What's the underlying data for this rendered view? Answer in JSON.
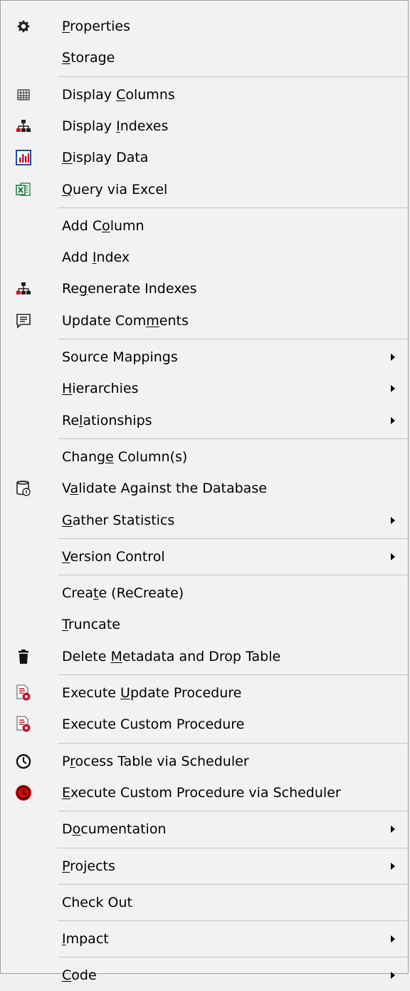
{
  "menu": {
    "items": [
      {
        "label": "Properties",
        "ul": 0,
        "icon": "gear-icon",
        "arrow": false
      },
      {
        "label": "Storage",
        "ul": 0,
        "icon": "",
        "arrow": false
      },
      {
        "sep": true
      },
      {
        "label": "Display Columns",
        "ul": 8,
        "icon": "columns-grid-icon",
        "arrow": false
      },
      {
        "label": "Display Indexes",
        "ul": 8,
        "icon": "index-tree-icon",
        "arrow": false
      },
      {
        "label": "Display Data",
        "ul": 0,
        "icon": "bar-chart-icon",
        "arrow": false
      },
      {
        "label": "Query via Excel",
        "ul": 0,
        "icon": "excel-icon",
        "arrow": false
      },
      {
        "sep": true
      },
      {
        "label": "Add Column",
        "ul": 5,
        "icon": "",
        "arrow": false
      },
      {
        "label": "Add Index",
        "ul": 4,
        "icon": "",
        "arrow": false
      },
      {
        "label": "Regenerate Indexes",
        "ul": 2,
        "icon": "index-tree-icon",
        "arrow": false
      },
      {
        "label": "Update Comments",
        "ul": 10,
        "icon": "comment-icon",
        "arrow": false
      },
      {
        "sep": true
      },
      {
        "label": "Source Mappings",
        "ul": -1,
        "icon": "",
        "arrow": true
      },
      {
        "label": "Hierarchies",
        "ul": 0,
        "icon": "",
        "arrow": true
      },
      {
        "label": "Relationships",
        "ul": 2,
        "icon": "",
        "arrow": true
      },
      {
        "sep": true
      },
      {
        "label": "Change Column(s)",
        "ul": 5,
        "icon": "",
        "arrow": false
      },
      {
        "label": "Validate Against the Database",
        "ul": 1,
        "icon": "database-validate-icon",
        "arrow": false
      },
      {
        "label": "Gather Statistics",
        "ul": 0,
        "icon": "",
        "arrow": true
      },
      {
        "sep": true
      },
      {
        "label": "Version Control",
        "ul": 0,
        "icon": "",
        "arrow": true
      },
      {
        "sep": true
      },
      {
        "label": "Create (ReCreate)",
        "ul": 4,
        "icon": "",
        "arrow": false
      },
      {
        "label": "Truncate",
        "ul": 0,
        "icon": "",
        "arrow": false
      },
      {
        "label": "Delete Metadata and Drop Table",
        "ul": 7,
        "icon": "trash-icon",
        "arrow": false
      },
      {
        "sep": true
      },
      {
        "label": "Execute Update Procedure",
        "ul": 8,
        "icon": "procedure-run-icon",
        "arrow": false
      },
      {
        "label": "Execute Custom Procedure",
        "ul": -1,
        "icon": "procedure-run-icon",
        "arrow": false
      },
      {
        "sep": true
      },
      {
        "label": "Process Table via Scheduler",
        "ul": 1,
        "icon": "clock-icon",
        "arrow": false
      },
      {
        "label": "Execute Custom Procedure via Scheduler",
        "ul": 0,
        "icon": "red-clock-icon",
        "arrow": false
      },
      {
        "sep": true
      },
      {
        "label": "Documentation",
        "ul": 1,
        "icon": "",
        "arrow": true
      },
      {
        "sep": true
      },
      {
        "label": "Projects",
        "ul": 0,
        "icon": "",
        "arrow": true
      },
      {
        "sep": true
      },
      {
        "label": "Check Out",
        "ul": -1,
        "icon": "",
        "arrow": false
      },
      {
        "sep": true
      },
      {
        "label": "Impact",
        "ul": 0,
        "icon": "",
        "arrow": true
      },
      {
        "sep": true
      },
      {
        "label": "Code",
        "ul": 0,
        "icon": "",
        "arrow": true
      }
    ]
  }
}
